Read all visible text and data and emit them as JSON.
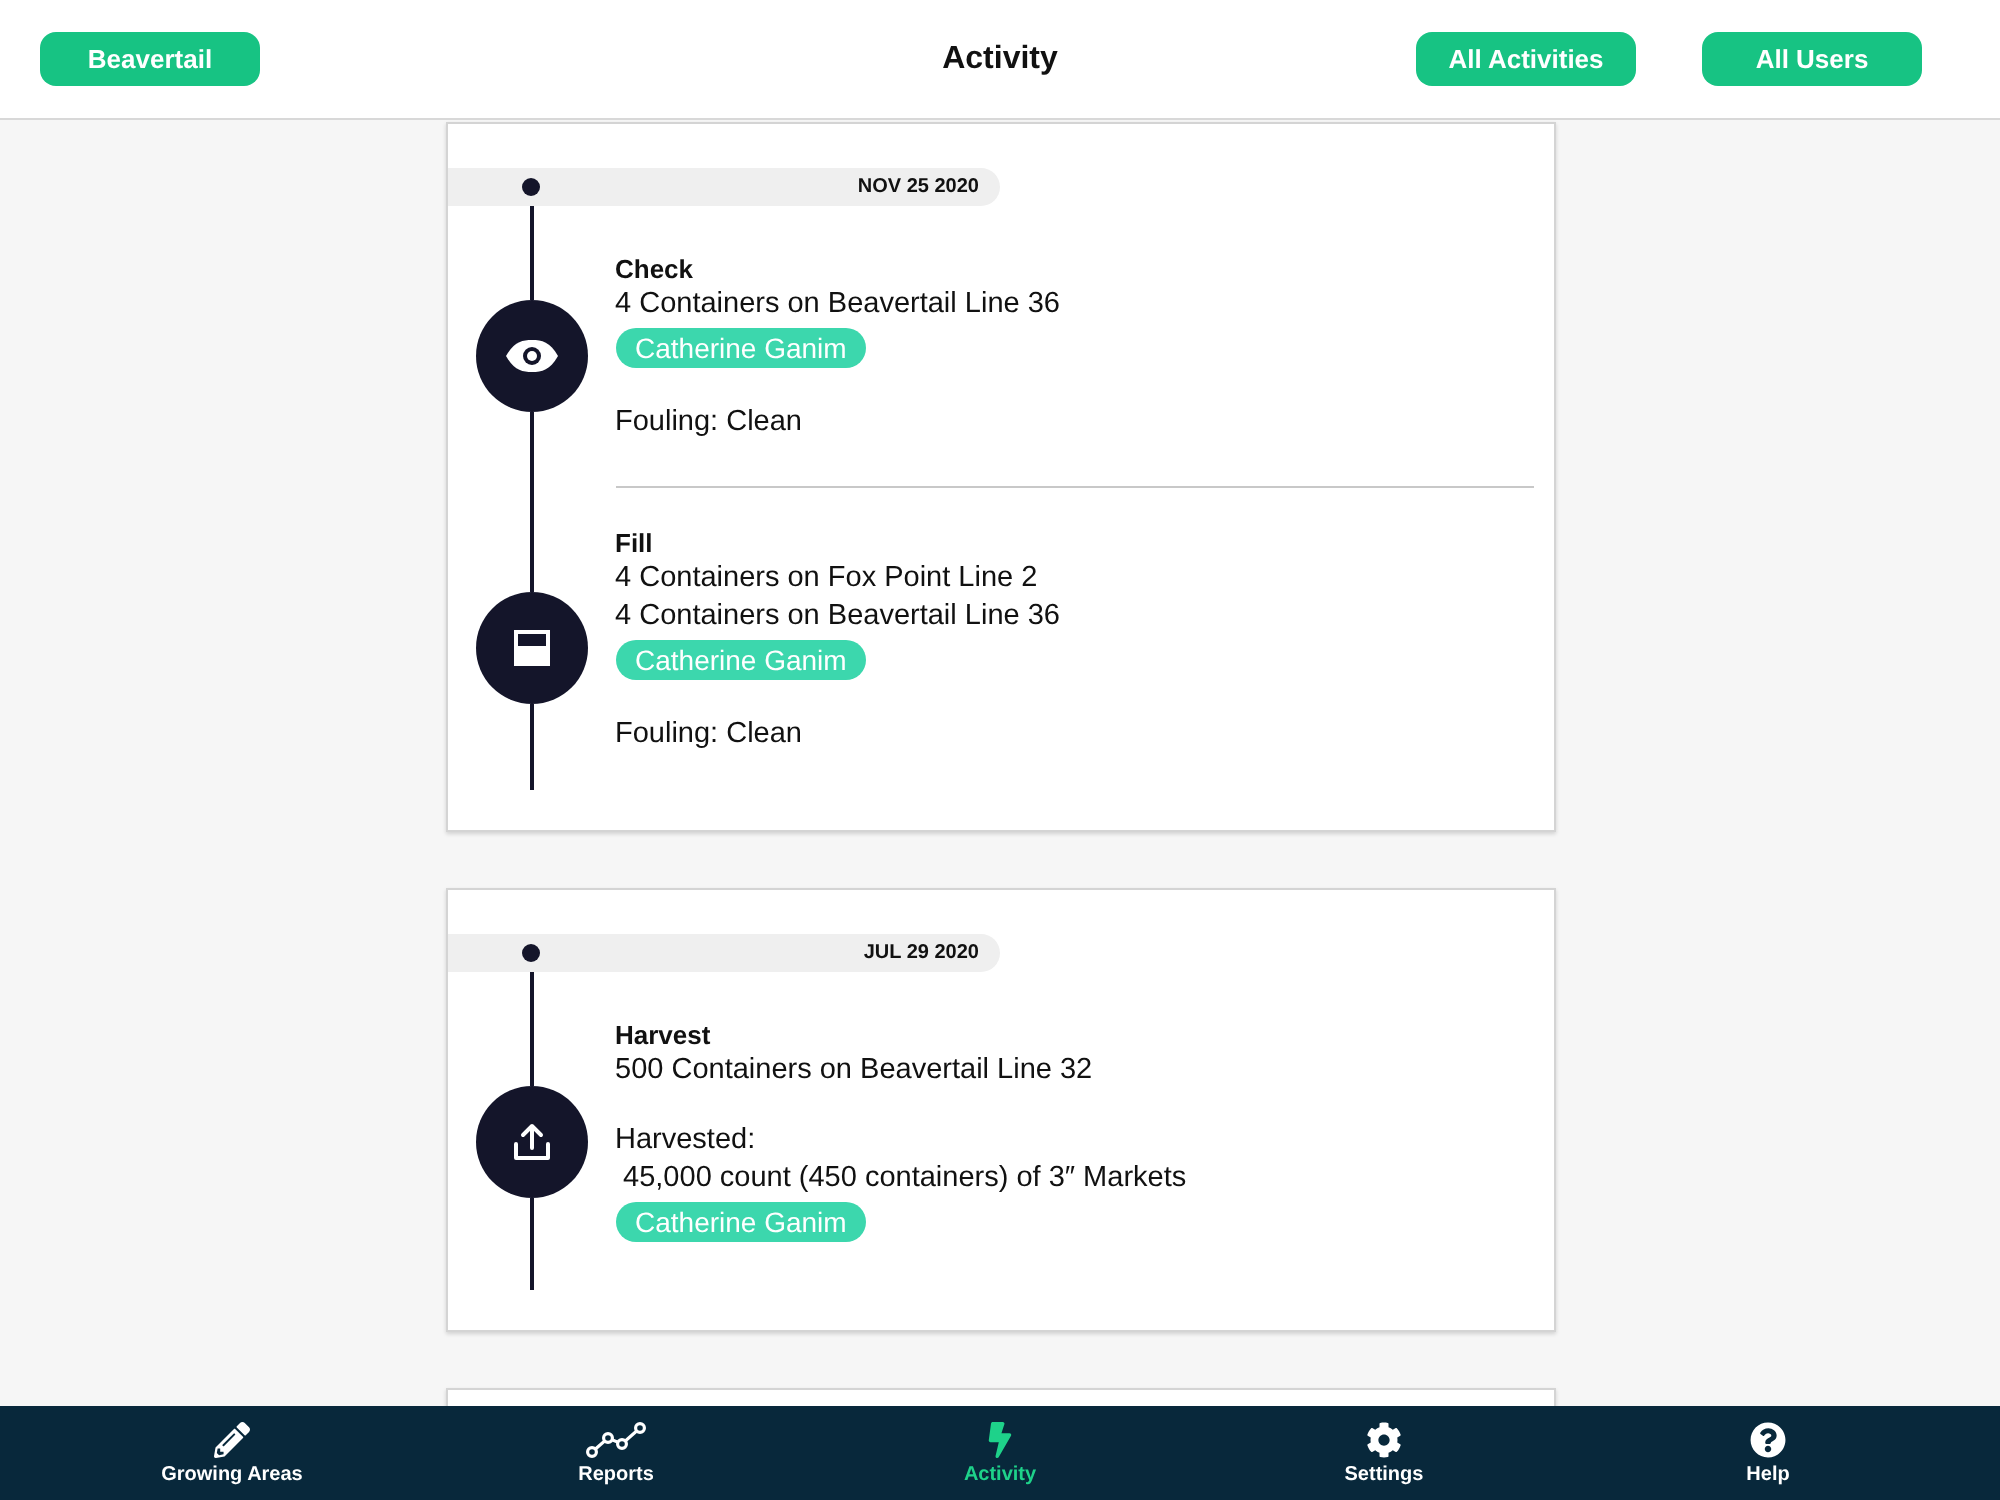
{
  "header": {
    "left_button": "Beavertail",
    "title": "Activity",
    "right_buttons": [
      "All Activities",
      "All Users"
    ]
  },
  "cards": [
    {
      "date": "NOV 25 2020",
      "entries": [
        {
          "kind": "check",
          "title": "Check",
          "rows": [
            {
              "kind": "text",
              "text": "4 Containers on Beavertail Line 36"
            },
            {
              "kind": "user",
              "text": "Catherine Ganim"
            },
            {
              "kind": "note",
              "text": "Fouling: Clean"
            }
          ]
        },
        {
          "kind": "fill",
          "title": "Fill",
          "rows": [
            {
              "kind": "text",
              "text": "4 Containers on Fox Point Line 2"
            },
            {
              "kind": "text",
              "text": "4 Containers on Beavertail Line 36"
            },
            {
              "kind": "user",
              "text": "Catherine Ganim"
            },
            {
              "kind": "note",
              "text": "Fouling: Clean"
            }
          ]
        }
      ]
    },
    {
      "date": "JUL 29 2020",
      "entries": [
        {
          "kind": "harvest",
          "title": "Harvest",
          "rows": [
            {
              "kind": "text",
              "text": "500 Containers on Beavertail Line 32"
            },
            {
              "kind": "note",
              "text": "Harvested:"
            },
            {
              "kind": "text",
              "text": " 45,000 count (450 containers) of 3″ Markets"
            },
            {
              "kind": "user",
              "text": "Catherine Ganim"
            }
          ]
        }
      ]
    }
  ],
  "tabs": [
    {
      "kind": "pencil",
      "label": "Growing Areas",
      "selected": false
    },
    {
      "kind": "reports",
      "label": "Reports",
      "selected": false
    },
    {
      "kind": "bolt",
      "label": "Activity",
      "selected": true
    },
    {
      "kind": "gear",
      "label": "Settings",
      "selected": false
    },
    {
      "kind": "help",
      "label": "Help",
      "selected": false
    }
  ]
}
